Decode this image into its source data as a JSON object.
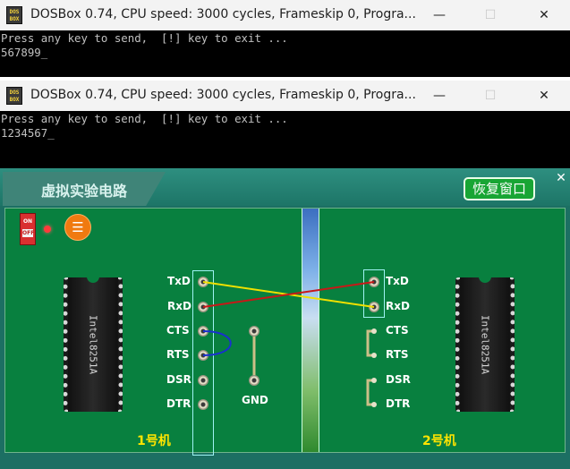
{
  "dosbox_window_1": {
    "title": "DOSBox 0.74, CPU speed:     3000 cycles, Frameskip  0, Progra...",
    "console_lines": [
      "Press any key to send,  [!] key to exit ...",
      "567899_"
    ]
  },
  "dosbox_window_2": {
    "title": "DOSBox 0.74, CPU speed:     3000 cycles, Frameskip  0, Progra...",
    "console_lines": [
      "Press any key to send,  [!] key to exit ...",
      "1234567_"
    ]
  },
  "window_controls": {
    "minimize": "—",
    "maximize": "☐",
    "close": "✕"
  },
  "app_icon_text": [
    "DOS",
    "BOX"
  ],
  "lab": {
    "title": "虚拟实验电路",
    "restore_button": "恢复窗口",
    "close": "✕",
    "switch": {
      "on": "ON",
      "off": "OFF"
    },
    "menu_icon": "☰",
    "chip_label": "Intel8251A",
    "left_pins": [
      "TxD",
      "RxD",
      "CTS",
      "RTS",
      "DSR",
      "DTR"
    ],
    "right_pins": [
      "TxD",
      "RxD",
      "CTS",
      "RTS",
      "DSR",
      "DTR"
    ],
    "gnd_label": "GND",
    "left_board_label": "1号机",
    "right_board_label": "2号机"
  },
  "colors": {
    "wire_txd_to_rxd": "#f0e000",
    "wire_rxd_to_txd": "#c81818",
    "wire_loop": "#1a2fd0",
    "board_green": "#08803f",
    "label_yellow": "#ffe400"
  }
}
